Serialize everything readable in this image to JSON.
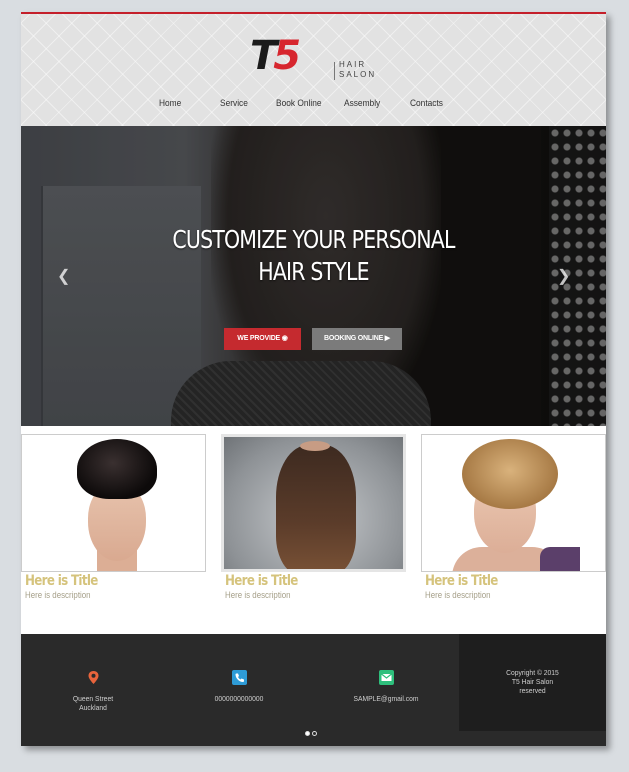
{
  "brand": {
    "mark_t": "T",
    "mark_5": "5",
    "sub_line1": "HAIR",
    "sub_line2": "SALON"
  },
  "nav": {
    "items": [
      "Home",
      "Service",
      "Book Online",
      "Assembly",
      "Contacts"
    ]
  },
  "hero": {
    "title_line1": "CUSTOMIZE YOUR PERSONAL",
    "title_line2": "HAIR STYLE",
    "btn_primary": "WE PROVIDE",
    "btn_secondary": "BOOKING ONLINE",
    "prev_icon": "chevron-left-icon",
    "next_icon": "chevron-right-icon"
  },
  "cards": [
    {
      "title": "Here is Title",
      "desc": "Here is description"
    },
    {
      "title": "Here is Title",
      "desc": "Here is description"
    },
    {
      "title": "Here is Title",
      "desc": "Here is description"
    }
  ],
  "footer": {
    "address_line1": "Queen Street",
    "address_line2": "Auckland",
    "phone": "0000000000000",
    "email": "SAMPLE@gmail.com",
    "copy_line1": "Copyright © 2015",
    "copy_line2": "T5 Hair Salon",
    "copy_line3": "reserved"
  },
  "colors": {
    "accent": "#d7262e",
    "card_title": "#d5c37c",
    "footer_bg": "#2a2a2a",
    "location": "#e8643c",
    "phone": "#2e9bd6",
    "email": "#2ebf7c"
  }
}
